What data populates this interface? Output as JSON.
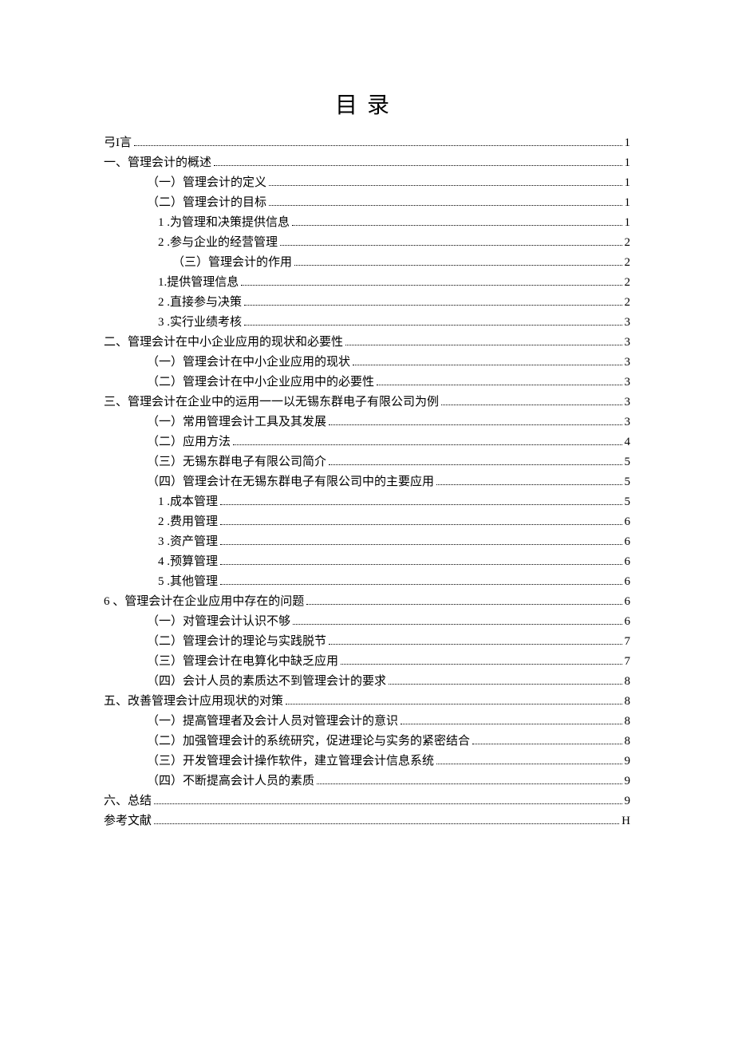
{
  "doc_title": "目录",
  "entries": [
    {
      "level": "lvl1",
      "text": "弓I言",
      "page": "1"
    },
    {
      "level": "lvl1",
      "text": "一、管理会计的概述",
      "page": "1"
    },
    {
      "level": "lvl2",
      "text": "（一）管理会计的定义",
      "page": "1"
    },
    {
      "level": "lvl2",
      "text": "（二）管理会计的目标",
      "page": "1"
    },
    {
      "level": "lvl3",
      "text": "1 .为管理和决策提供信息",
      "page": "1"
    },
    {
      "level": "lvl3",
      "text": "2 .参与企业的经营管理 ",
      "page": "2"
    },
    {
      "level": "lvl3b",
      "text": "（三）管理会计的作用 ",
      "page": "2"
    },
    {
      "level": "lvl3",
      "text": "1.提供管理信息",
      "page": "2"
    },
    {
      "level": "lvl3",
      "text": "2 .直接参与决策 ",
      "page": "2"
    },
    {
      "level": "lvl3",
      "text": "3 .实行业绩考核 ",
      "page": "3"
    },
    {
      "level": "lvl1",
      "text": "二、管理会计在中小企业应用的现状和必要性",
      "page": "3"
    },
    {
      "level": "lvl2",
      "text": "（一）管理会计在中小企业应用的现状",
      "page": "3"
    },
    {
      "level": "lvl2",
      "text": "（二）管理会计在中小企业应用中的必要性",
      "page": "3"
    },
    {
      "level": "lvl1",
      "text": "三、管理会计在企业中的运用一一以无锡东群电子有限公司为例",
      "page": "3"
    },
    {
      "level": "lvl2",
      "text": "（一）常用管理会计工具及其发展",
      "page": "3"
    },
    {
      "level": "lvl2",
      "text": "（二）应用方法",
      "page": "4"
    },
    {
      "level": "lvl2",
      "text": "（三）无锡东群电子有限公司简介",
      "page": "5"
    },
    {
      "level": "lvl2",
      "text": "（四）管理会计在无锡东群电子有限公司中的主要应用",
      "page": "5"
    },
    {
      "level": "lvl3",
      "text": "1 .成本管理",
      "page": "5"
    },
    {
      "level": "lvl3",
      "text": "2 .费用管理 ",
      "page": "6"
    },
    {
      "level": "lvl3",
      "text": "3 .资产管理 ",
      "page": "6"
    },
    {
      "level": "lvl3",
      "text": "4 .预算管理 ",
      "page": "6"
    },
    {
      "level": "lvl3",
      "text": "5 .其他管理 ",
      "page": "6"
    },
    {
      "level": "lvl1",
      "text": "6  、管理会计在企业应用中存在的问题 ",
      "page": "6"
    },
    {
      "level": "lvl2",
      "text": "（一）对管理会计认识不够",
      "page": "6"
    },
    {
      "level": "lvl2",
      "text": "（二）管理会计的理论与实践脱节",
      "page": "7"
    },
    {
      "level": "lvl2",
      "text": "（三）管理会计在电算化中缺乏应用",
      "page": "7"
    },
    {
      "level": "lvl2",
      "text": "（四）会计人员的素质达不到管理会计的要求",
      "page": "8"
    },
    {
      "level": "lvl1",
      "text": "五、改善管理会计应用现状的对策",
      "page": "8"
    },
    {
      "level": "lvl2",
      "text": "（一）提高管理者及会计人员对管理会计的意识",
      "page": "8"
    },
    {
      "level": "lvl2",
      "text": "（二）加强管理会计的系统研究，促进理论与实务的紧密结合",
      "page": "8"
    },
    {
      "level": "lvl2",
      "text": "（三）开发管理会计操作软件，建立管理会计信息系统",
      "page": "9"
    },
    {
      "level": "lvl2",
      "text": "（四）不断提高会计人员的素质",
      "page": "9"
    },
    {
      "level": "lvl1",
      "text": "六、总结",
      "page": "9"
    },
    {
      "level": "lvl1",
      "text": "参考文献",
      "page": "H"
    }
  ]
}
